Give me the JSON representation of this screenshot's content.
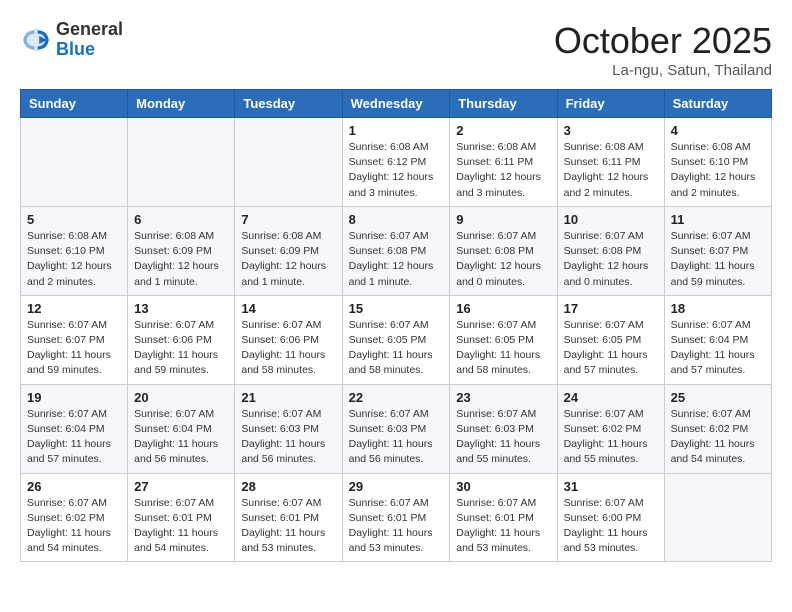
{
  "logo": {
    "general": "General",
    "blue": "Blue"
  },
  "header": {
    "month": "October 2025",
    "location": "La-ngu, Satun, Thailand"
  },
  "days_of_week": [
    "Sunday",
    "Monday",
    "Tuesday",
    "Wednesday",
    "Thursday",
    "Friday",
    "Saturday"
  ],
  "weeks": [
    [
      {
        "day": "",
        "info": ""
      },
      {
        "day": "",
        "info": ""
      },
      {
        "day": "",
        "info": ""
      },
      {
        "day": "1",
        "info": "Sunrise: 6:08 AM\nSunset: 6:12 PM\nDaylight: 12 hours\nand 3 minutes."
      },
      {
        "day": "2",
        "info": "Sunrise: 6:08 AM\nSunset: 6:11 PM\nDaylight: 12 hours\nand 3 minutes."
      },
      {
        "day": "3",
        "info": "Sunrise: 6:08 AM\nSunset: 6:11 PM\nDaylight: 12 hours\nand 2 minutes."
      },
      {
        "day": "4",
        "info": "Sunrise: 6:08 AM\nSunset: 6:10 PM\nDaylight: 12 hours\nand 2 minutes."
      }
    ],
    [
      {
        "day": "5",
        "info": "Sunrise: 6:08 AM\nSunset: 6:10 PM\nDaylight: 12 hours\nand 2 minutes."
      },
      {
        "day": "6",
        "info": "Sunrise: 6:08 AM\nSunset: 6:09 PM\nDaylight: 12 hours\nand 1 minute."
      },
      {
        "day": "7",
        "info": "Sunrise: 6:08 AM\nSunset: 6:09 PM\nDaylight: 12 hours\nand 1 minute."
      },
      {
        "day": "8",
        "info": "Sunrise: 6:07 AM\nSunset: 6:08 PM\nDaylight: 12 hours\nand 1 minute."
      },
      {
        "day": "9",
        "info": "Sunrise: 6:07 AM\nSunset: 6:08 PM\nDaylight: 12 hours\nand 0 minutes."
      },
      {
        "day": "10",
        "info": "Sunrise: 6:07 AM\nSunset: 6:08 PM\nDaylight: 12 hours\nand 0 minutes."
      },
      {
        "day": "11",
        "info": "Sunrise: 6:07 AM\nSunset: 6:07 PM\nDaylight: 11 hours\nand 59 minutes."
      }
    ],
    [
      {
        "day": "12",
        "info": "Sunrise: 6:07 AM\nSunset: 6:07 PM\nDaylight: 11 hours\nand 59 minutes."
      },
      {
        "day": "13",
        "info": "Sunrise: 6:07 AM\nSunset: 6:06 PM\nDaylight: 11 hours\nand 59 minutes."
      },
      {
        "day": "14",
        "info": "Sunrise: 6:07 AM\nSunset: 6:06 PM\nDaylight: 11 hours\nand 58 minutes."
      },
      {
        "day": "15",
        "info": "Sunrise: 6:07 AM\nSunset: 6:05 PM\nDaylight: 11 hours\nand 58 minutes."
      },
      {
        "day": "16",
        "info": "Sunrise: 6:07 AM\nSunset: 6:05 PM\nDaylight: 11 hours\nand 58 minutes."
      },
      {
        "day": "17",
        "info": "Sunrise: 6:07 AM\nSunset: 6:05 PM\nDaylight: 11 hours\nand 57 minutes."
      },
      {
        "day": "18",
        "info": "Sunrise: 6:07 AM\nSunset: 6:04 PM\nDaylight: 11 hours\nand 57 minutes."
      }
    ],
    [
      {
        "day": "19",
        "info": "Sunrise: 6:07 AM\nSunset: 6:04 PM\nDaylight: 11 hours\nand 57 minutes."
      },
      {
        "day": "20",
        "info": "Sunrise: 6:07 AM\nSunset: 6:04 PM\nDaylight: 11 hours\nand 56 minutes."
      },
      {
        "day": "21",
        "info": "Sunrise: 6:07 AM\nSunset: 6:03 PM\nDaylight: 11 hours\nand 56 minutes."
      },
      {
        "day": "22",
        "info": "Sunrise: 6:07 AM\nSunset: 6:03 PM\nDaylight: 11 hours\nand 56 minutes."
      },
      {
        "day": "23",
        "info": "Sunrise: 6:07 AM\nSunset: 6:03 PM\nDaylight: 11 hours\nand 55 minutes."
      },
      {
        "day": "24",
        "info": "Sunrise: 6:07 AM\nSunset: 6:02 PM\nDaylight: 11 hours\nand 55 minutes."
      },
      {
        "day": "25",
        "info": "Sunrise: 6:07 AM\nSunset: 6:02 PM\nDaylight: 11 hours\nand 54 minutes."
      }
    ],
    [
      {
        "day": "26",
        "info": "Sunrise: 6:07 AM\nSunset: 6:02 PM\nDaylight: 11 hours\nand 54 minutes."
      },
      {
        "day": "27",
        "info": "Sunrise: 6:07 AM\nSunset: 6:01 PM\nDaylight: 11 hours\nand 54 minutes."
      },
      {
        "day": "28",
        "info": "Sunrise: 6:07 AM\nSunset: 6:01 PM\nDaylight: 11 hours\nand 53 minutes."
      },
      {
        "day": "29",
        "info": "Sunrise: 6:07 AM\nSunset: 6:01 PM\nDaylight: 11 hours\nand 53 minutes."
      },
      {
        "day": "30",
        "info": "Sunrise: 6:07 AM\nSunset: 6:01 PM\nDaylight: 11 hours\nand 53 minutes."
      },
      {
        "day": "31",
        "info": "Sunrise: 6:07 AM\nSunset: 6:00 PM\nDaylight: 11 hours\nand 53 minutes."
      },
      {
        "day": "",
        "info": ""
      }
    ]
  ]
}
